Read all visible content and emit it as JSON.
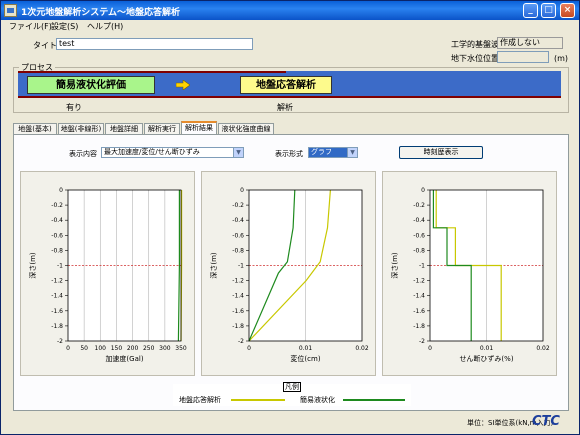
{
  "window": {
    "title": "1次元地盤解析システム〜地盤応答解析"
  },
  "menu": [
    "ファイル(F)",
    "設定(S)",
    "ヘルプ(H)"
  ],
  "header": {
    "title_label": "タイトル",
    "title_value": "test",
    "base_label": "工学的基盤波",
    "base_value": "作成しない",
    "groundwater_label": "地下水位位置",
    "groundwater_value": "",
    "groundwater_unit": "(m)"
  },
  "process": {
    "legend": "プロセス",
    "step1_label": "簡易液状化評価",
    "step1_status": "有り",
    "step2_label": "地盤応答解析",
    "step2_status": "解析"
  },
  "tabs": [
    "地盤(基本)",
    "地盤(非線形)",
    "地盤詳細",
    "解析実行",
    "解析結果",
    "液状化強度曲線"
  ],
  "active_tab": 4,
  "results": {
    "display_content_label": "表示内容",
    "display_content_value": "最大加速度/変位/せん断ひずみ",
    "display_format_label": "表示形式",
    "display_format_value": "グラフ",
    "timeseries_button": "時刻歴表示"
  },
  "chart_data": [
    {
      "type": "line",
      "xlabel": "加速度(Gal)",
      "ylabel": "深さ(m)",
      "xlim": [
        0,
        350
      ],
      "ylim": [
        -2,
        0
      ],
      "xticks": [
        "0",
        "50",
        "100",
        "150",
        "200",
        "250",
        "300",
        "350"
      ],
      "yticks": [
        "0",
        "-0.2",
        "-0.4",
        "-0.6",
        "-0.8",
        "-1",
        "-1.2",
        "-1.4",
        "-1.6",
        "-1.8",
        "-2"
      ],
      "series": [
        {
          "name": "地盤応答解析",
          "color": "#c8c800",
          "x": [
            352,
            352,
            350
          ],
          "y": [
            0,
            -1,
            -2
          ]
        },
        {
          "name": "簡易液状化",
          "color": "#1e8a1e",
          "x": [
            345,
            345,
            342
          ],
          "y": [
            0,
            -1,
            -2
          ]
        }
      ]
    },
    {
      "type": "line",
      "xlabel": "変位(cm)",
      "ylabel": "深さ(m)",
      "xlim": [
        0,
        0.02
      ],
      "ylim": [
        -2,
        0
      ],
      "xticks": [
        "0",
        "0.01",
        "0.02"
      ],
      "yticks": [
        "0",
        "-0.2",
        "-0.4",
        "-0.6",
        "-0.8",
        "-1",
        "-1.2",
        "-1.4",
        "-1.6",
        "-1.8",
        "-2"
      ],
      "series": [
        {
          "name": "地盤応答解析",
          "color": "#c8c800",
          "x": [
            0.0144,
            0.0139,
            0.0126,
            0.0101,
            0.0
          ],
          "y": [
            0,
            -0.5,
            -0.95,
            -1.2,
            -2
          ]
        },
        {
          "name": "簡易液状化",
          "color": "#1e8a1e",
          "x": [
            0.0081,
            0.0078,
            0.0068,
            0.0052,
            0.0
          ],
          "y": [
            0,
            -0.5,
            -0.95,
            -1.1,
            -2
          ]
        }
      ]
    },
    {
      "type": "line",
      "xlabel": "せん断ひずみ(%)",
      "ylabel": "深さ(m)",
      "xlim": [
        0,
        0.02
      ],
      "ylim": [
        -2,
        0
      ],
      "xticks": [
        "0",
        "0.01",
        "0.02"
      ],
      "yticks": [
        "0",
        "-0.2",
        "-0.4",
        "-0.6",
        "-0.8",
        "-1",
        "-1.2",
        "-1.4",
        "-1.6",
        "-1.8",
        "-2"
      ],
      "series": [
        {
          "name": "地盤応答解析",
          "color": "#c8c800",
          "x": [
            0.0011,
            0.0011,
            0.0045,
            0.0045,
            0.0126,
            0.0126
          ],
          "y": [
            0,
            -0.5,
            -0.5,
            -1,
            -1,
            -2
          ]
        },
        {
          "name": "簡易液状化",
          "color": "#1e8a1e",
          "x": [
            0.0006,
            0.0006,
            0.003,
            0.003,
            0.0073,
            0.0073
          ],
          "y": [
            0,
            -0.5,
            -0.5,
            -1,
            -1,
            -2
          ]
        }
      ]
    }
  ],
  "legend": {
    "title": "凡例",
    "item1": "地盤応答解析",
    "item2": "簡易液状化",
    "color1": "#c8c800",
    "color2": "#1e8a1e"
  },
  "footer": {
    "units": "単位：SI単位系(kN,m入力)",
    "logo": "CTC"
  }
}
